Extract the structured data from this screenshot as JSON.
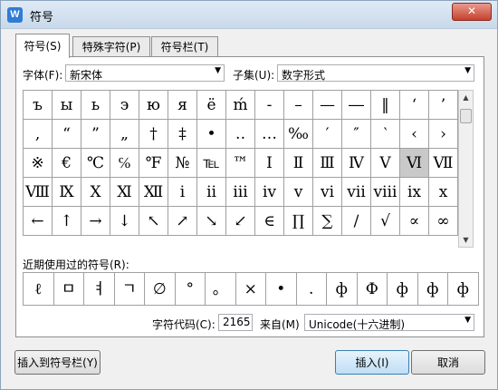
{
  "window": {
    "title": "符号",
    "app_icon": "W",
    "close": "✕"
  },
  "tabs": [
    "符号(S)",
    "特殊字符(P)",
    "符号栏(T)"
  ],
  "font": {
    "label": "字体(F):",
    "value": "新宋体"
  },
  "subset": {
    "label": "子集(U):",
    "value": "数字形式"
  },
  "symbols": [
    [
      "ъ",
      "ы",
      "ь",
      "э",
      "ю",
      "я",
      "ё",
      "ḿ",
      "-",
      "–",
      "—",
      "―",
      "‖",
      "‘",
      "’"
    ],
    [
      "‚",
      "“",
      "”",
      "„",
      "†",
      "‡",
      "•",
      "‥",
      "…",
      "‰",
      "′",
      "″",
      "‵",
      "‹",
      "›"
    ],
    [
      "※",
      "€",
      "℃",
      "℅",
      "℉",
      "№",
      "℡",
      "™",
      "Ⅰ",
      "Ⅱ",
      "Ⅲ",
      "Ⅳ",
      "Ⅴ",
      "Ⅵ",
      "Ⅶ"
    ],
    [
      "Ⅷ",
      "Ⅸ",
      "Ⅹ",
      "Ⅺ",
      "Ⅻ",
      "ⅰ",
      "ⅱ",
      "ⅲ",
      "ⅳ",
      "ⅴ",
      "ⅵ",
      "ⅶ",
      "ⅷ",
      "ⅸ",
      "ⅹ"
    ],
    [
      "←",
      "↑",
      "→",
      "↓",
      "↖",
      "↗",
      "↘",
      "↙",
      "∈",
      "∏",
      "∑",
      "∕",
      "√",
      "∝",
      "∞"
    ]
  ],
  "selected_symbol": "Ⅵ",
  "recent_label": "近期使用过的符号(R):",
  "recent": [
    "ℓ",
    "ㅁ",
    "ㅕ",
    "ㄱ",
    "∅",
    "°",
    "。",
    "×",
    "•",
    ".",
    "ф",
    "Ф",
    "ф",
    "ф",
    "ф"
  ],
  "code": {
    "label": "字符代码(C):",
    "value": "2165",
    "from_label": "来自(M)",
    "from_value": "Unicode(十六进制)"
  },
  "buttons": {
    "insert_to_bar": "插入到符号栏(Y)",
    "insert": "插入(I)",
    "cancel": "取消"
  }
}
